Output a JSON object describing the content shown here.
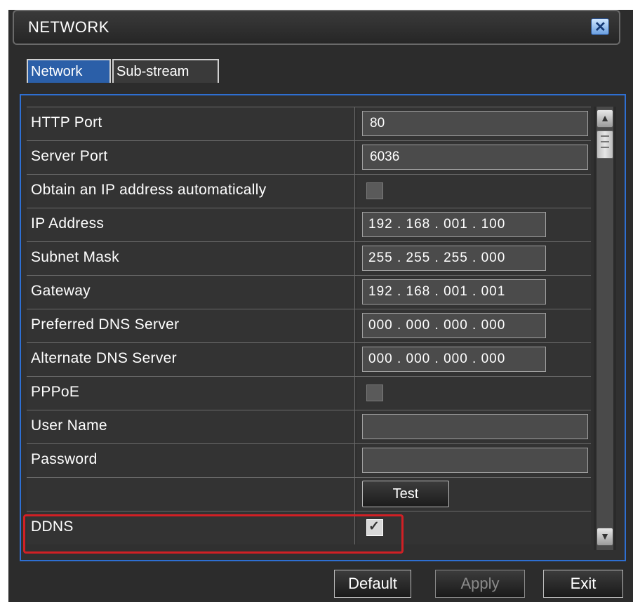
{
  "window": {
    "title": "NETWORK"
  },
  "tabs": [
    {
      "label": "Network",
      "active": true
    },
    {
      "label": "Sub-stream",
      "active": false
    }
  ],
  "rows": [
    {
      "label": "HTTP Port",
      "type": "text",
      "value": "80"
    },
    {
      "label": "Server Port",
      "type": "text",
      "value": "6036"
    },
    {
      "label": "Obtain an IP address automatically",
      "type": "checkbox",
      "checked": false
    },
    {
      "label": "IP Address",
      "type": "ip",
      "value": "192 . 168 . 001 . 100"
    },
    {
      "label": "Subnet Mask",
      "type": "ip",
      "value": "255 . 255 . 255 . 000"
    },
    {
      "label": "Gateway",
      "type": "ip",
      "value": "192 . 168 . 001 . 001"
    },
    {
      "label": "Preferred DNS Server",
      "type": "ip",
      "value": "000 . 000 . 000 . 000"
    },
    {
      "label": "Alternate DNS Server",
      "type": "ip",
      "value": "000 . 000 . 000 . 000"
    },
    {
      "label": "PPPoE",
      "type": "checkbox",
      "checked": false
    },
    {
      "label": "User Name",
      "type": "text",
      "value": ""
    },
    {
      "label": "Password",
      "type": "text",
      "value": ""
    },
    {
      "label": "",
      "type": "button",
      "button_label": "Test"
    },
    {
      "label": "DDNS",
      "type": "checkbox",
      "checked": true
    }
  ],
  "footer": {
    "default_label": "Default",
    "apply_label": "Apply",
    "exit_label": "Exit"
  },
  "colors": {
    "highlight": "#d12025",
    "panel_border": "#2e6fd2",
    "active_tab": "#2b5fa8"
  }
}
